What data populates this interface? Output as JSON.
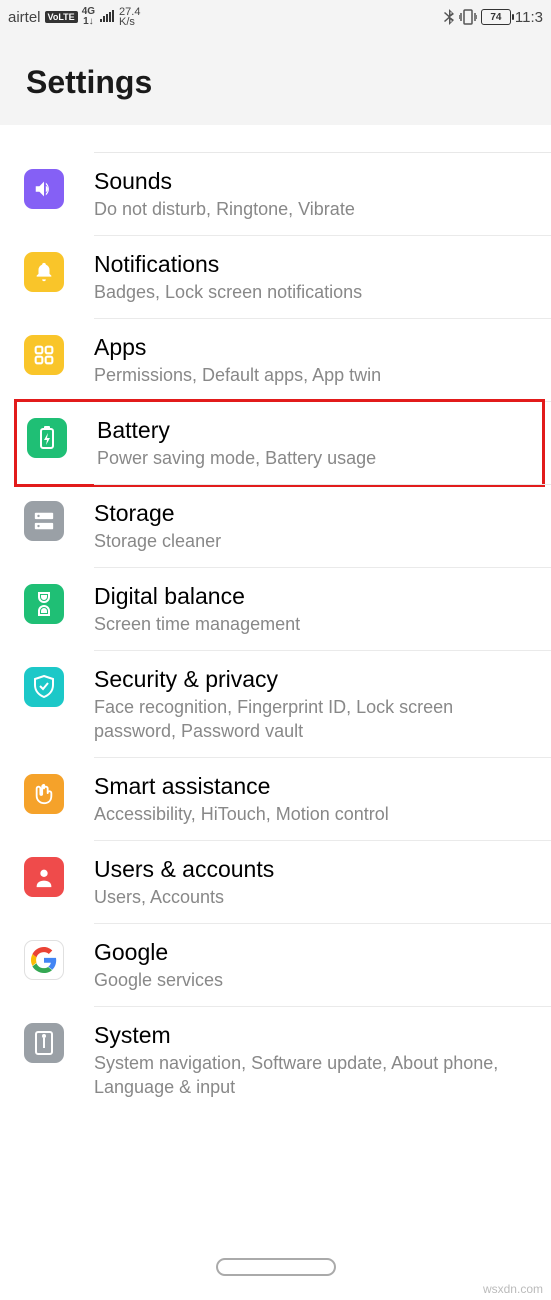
{
  "statusbar": {
    "carrier": "airtel",
    "volte": "VoLTE",
    "network_top": "4G",
    "network_bot": "1↓",
    "speed_top": "27.4",
    "speed_bot": "K/s",
    "battery": "74",
    "time": "11:3"
  },
  "header": {
    "title": "Settings"
  },
  "items": [
    {
      "title": "Sounds",
      "sub": "Do not disturb, Ringtone, Vibrate"
    },
    {
      "title": "Notifications",
      "sub": "Badges, Lock screen notifications"
    },
    {
      "title": "Apps",
      "sub": "Permissions, Default apps, App twin"
    },
    {
      "title": "Battery",
      "sub": "Power saving mode, Battery usage"
    },
    {
      "title": "Storage",
      "sub": "Storage cleaner"
    },
    {
      "title": "Digital balance",
      "sub": "Screen time management"
    },
    {
      "title": "Security & privacy",
      "sub": "Face recognition, Fingerprint ID, Lock screen password, Password vault"
    },
    {
      "title": "Smart assistance",
      "sub": "Accessibility, HiTouch, Motion control"
    },
    {
      "title": "Users & accounts",
      "sub": "Users, Accounts"
    },
    {
      "title": "Google",
      "sub": "Google services"
    },
    {
      "title": "System",
      "sub": "System navigation, Software update, About phone, Language & input"
    }
  ],
  "watermark": "wsxdn.com"
}
